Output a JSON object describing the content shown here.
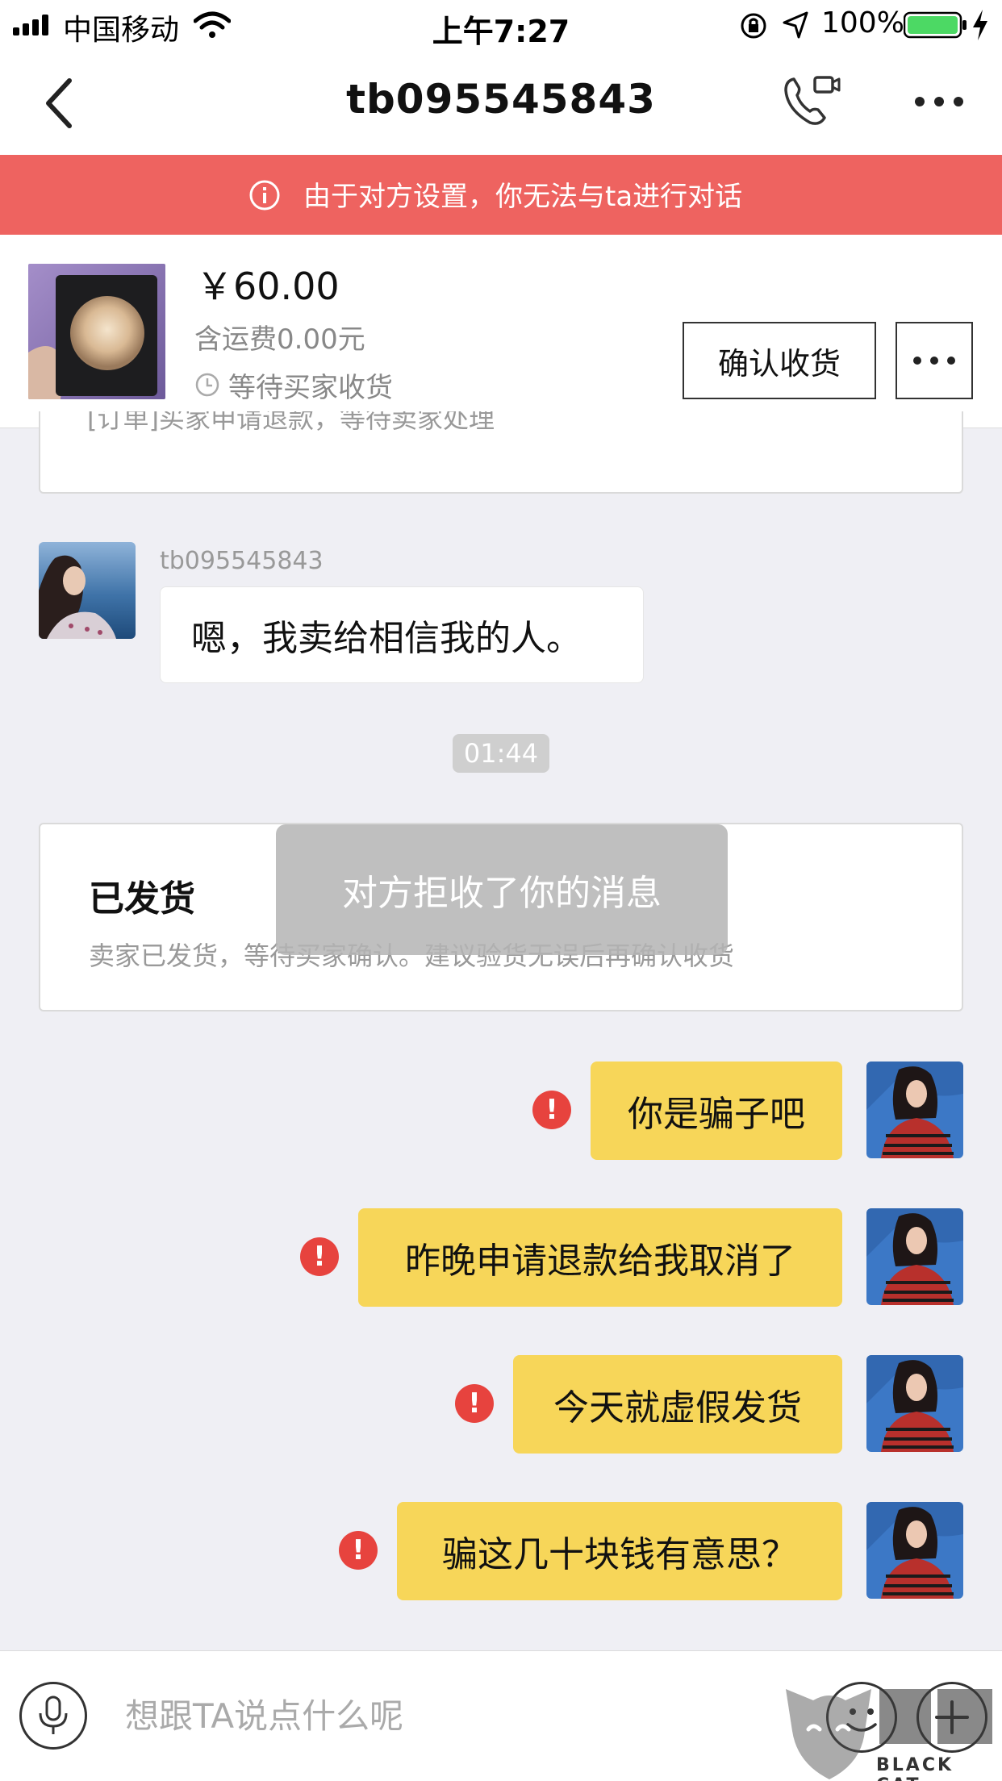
{
  "status_bar": {
    "carrier": "中国移动",
    "time": "上午7:27",
    "battery": "100%"
  },
  "nav": {
    "title": "tb095545843"
  },
  "banner": {
    "text": "由于对方设置，你无法与ta进行对话",
    "color": "#ee6360"
  },
  "order": {
    "price": "￥60.00",
    "shipping": "含运费0.00元",
    "status": "等待买家收货",
    "confirm_label": "确认收货"
  },
  "chat": {
    "partial_card_text": "[订单]买家申请退款，等待卖家处理",
    "incoming": {
      "sender": "tb095545843",
      "text": "嗯，我卖给相信我的人。"
    },
    "time_separator": "01:44",
    "shipped_card": {
      "title": "已发货",
      "desc": "卖家已发货，等待买家确认。建议验货无误后再确认收货"
    },
    "toast": "对方拒收了你的消息",
    "outgoing": [
      {
        "text": "你是骗子吧"
      },
      {
        "text": "昨晚申请退款给我取消了"
      },
      {
        "text": "今天就虚假发货"
      },
      {
        "text": "骗这几十块钱有意思？"
      }
    ],
    "bubble_color": "#f7d659",
    "error_color": "#e7433e"
  },
  "input": {
    "placeholder": "想跟TA说点什么呢"
  },
  "watermark": {
    "text": "BLACK CAT"
  }
}
